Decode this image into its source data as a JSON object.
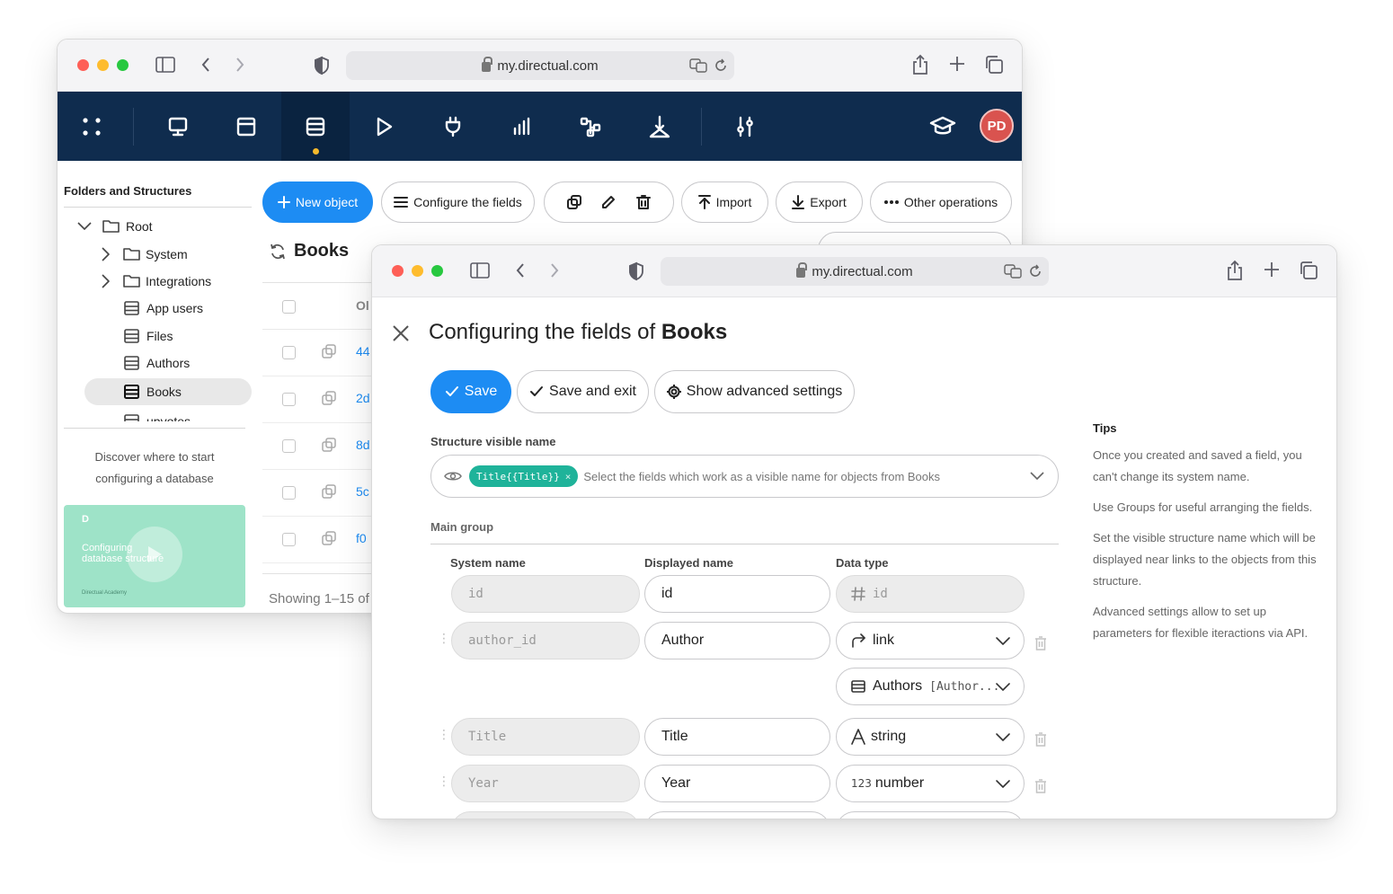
{
  "back_window": {
    "url": "my.directual.com",
    "avatar_initials": "PD",
    "nav_icons": [
      "apps-icon",
      "monitor-icon",
      "layout-icon",
      "database-icon",
      "play-icon",
      "plug-icon",
      "chart-icon",
      "flow-icon",
      "merge-icon",
      "sliders-icon"
    ],
    "sidebar": {
      "title": "Folders and Structures",
      "tree": [
        {
          "label": "Root",
          "type": "folder",
          "expanded": true
        },
        {
          "label": "System",
          "type": "folder"
        },
        {
          "label": "Integrations",
          "type": "folder"
        },
        {
          "label": "App users",
          "type": "table"
        },
        {
          "label": "Files",
          "type": "table"
        },
        {
          "label": "Authors",
          "type": "table"
        },
        {
          "label": "Books",
          "type": "table",
          "selected": true
        },
        {
          "label": "upvotes",
          "type": "table"
        }
      ],
      "discover_line1": "Discover where to start",
      "discover_line2": "configuring a database",
      "video_title_line1": "Configuring",
      "video_title_line2": "database structure",
      "video_caption": "Directual Academy"
    },
    "toolbar": {
      "new_object": "New object",
      "configure_fields": "Configure the fields",
      "import": "Import",
      "export": "Export",
      "other_operations": "Other operations"
    },
    "structure_title": "Books",
    "table": {
      "header_partial": "Ol",
      "row_ids": [
        "44",
        "2d",
        "8d",
        "5c",
        "f0"
      ]
    },
    "footer": "Showing 1–15 of"
  },
  "front_window": {
    "url": "my.directual.com",
    "heading_prefix": "Configuring the fields of",
    "heading_bold": "Books",
    "buttons": {
      "save": "Save",
      "save_exit": "Save and exit",
      "advanced": "Show advanced settings"
    },
    "visible_name": {
      "label": "Structure visible name",
      "tag": "Title{{Title}}",
      "placeholder": "Select the fields which work as a visible name for objects from Books"
    },
    "group_title": "Main group",
    "columns": {
      "system": "System name",
      "displayed": "Displayed name",
      "type": "Data type"
    },
    "fields": [
      {
        "system": "id",
        "displayed": "id",
        "type": "id",
        "type_icon": "hash-icon",
        "locked": true
      },
      {
        "system": "author_id",
        "displayed": "Author",
        "type": "link",
        "type_icon": "link-icon",
        "sub_label": "Authors",
        "sub_code": "[Author..."
      },
      {
        "system": "Title",
        "displayed": "Title",
        "type": "string",
        "type_icon": "letter-a-icon"
      },
      {
        "system": "Year",
        "displayed": "Year",
        "type": "number",
        "type_icon": "number-123-icon",
        "type_prefix": "123"
      }
    ],
    "tips": {
      "title": "Tips",
      "items": [
        "Once you created and saved a field, you can't change its system name.",
        "Use Groups for useful arranging the fields.",
        "Set the visible structure name which will be displayed near links to the objects from this structure.",
        "Advanced settings allow to set up parameters for flexible iteractions via API."
      ]
    }
  },
  "colors": {
    "accent": "#1d8cf3",
    "navbar": "#0f2c4e",
    "tag": "#1fb39a",
    "avatar": "#d9534f",
    "video_bg": "#9ee3c8"
  }
}
